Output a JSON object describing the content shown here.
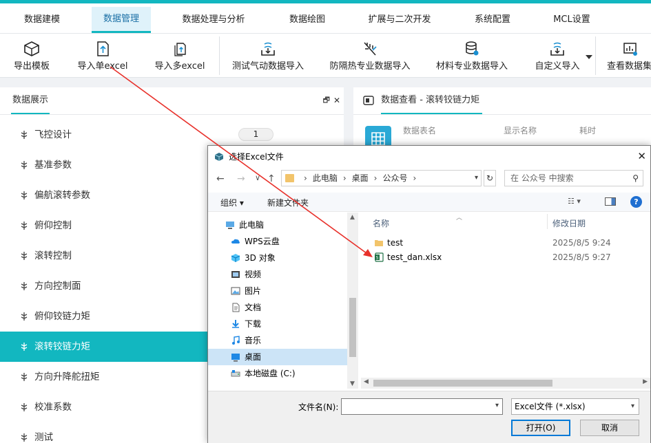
{
  "menu": {
    "tabs": [
      {
        "label": "数据建模"
      },
      {
        "label": "数据管理"
      },
      {
        "label": "数据处理与分析"
      },
      {
        "label": "数据绘图"
      },
      {
        "label": "扩展与二次开发"
      },
      {
        "label": "系统配置"
      },
      {
        "label": "MCL设置"
      }
    ],
    "active_index": 1
  },
  "toolbar": {
    "buttons": [
      {
        "label": "导出模板",
        "icon": "cube-icon"
      },
      {
        "label": "导入单excel",
        "icon": "import-file-icon"
      },
      {
        "label": "导入多excel",
        "icon": "import-multi-file-icon"
      },
      {
        "label": "测试气动数据导入",
        "icon": "import-tray-icon"
      },
      {
        "label": "防隔热专业数据导入",
        "icon": "heat-shield-icon"
      },
      {
        "label": "材料专业数据导入",
        "icon": "database-icon"
      },
      {
        "label": "自定义导入",
        "icon": "import-tray-icon"
      },
      {
        "label": "查看数据集",
        "icon": "dataset-view-icon"
      }
    ]
  },
  "left_panel": {
    "title": "数据展示",
    "pin_glyph": "🗗",
    "close_glyph": "✕",
    "badge": "1",
    "items": [
      {
        "label": "飞控设计"
      },
      {
        "label": "基准参数"
      },
      {
        "label": "偏航滚转参数"
      },
      {
        "label": "俯仰控制"
      },
      {
        "label": "滚转控制"
      },
      {
        "label": "方向控制面"
      },
      {
        "label": "俯仰铰链力矩"
      },
      {
        "label": "滚转铰链力矩"
      },
      {
        "label": "方向升降舵扭矩"
      },
      {
        "label": "校准系数"
      },
      {
        "label": "测试"
      }
    ],
    "selected_index": 7
  },
  "right_panel": {
    "title": "数据查看 - 滚转铰链力矩",
    "columns": [
      "数据表名",
      "显示名称",
      "耗时"
    ]
  },
  "dialog": {
    "title": "选择Excel文件",
    "close_glyph": "✕",
    "nav": {
      "back": "←",
      "forward": "→",
      "recent": "∨",
      "up": "↑",
      "refresh": "↻"
    },
    "address": [
      "此电脑",
      "桌面",
      "公众号"
    ],
    "address_sep": "›",
    "search_placeholder": "在 公众号 中搜索",
    "commands": {
      "organize": "组织 ▾",
      "new_folder": "新建文件夹",
      "help": "?",
      "view": "☷ ▾"
    },
    "nav_pane": [
      {
        "label": "此电脑",
        "icon": "computer-icon",
        "top": true
      },
      {
        "label": "WPS云盘",
        "icon": "cloud-icon"
      },
      {
        "label": "3D 对象",
        "icon": "3d-object-icon"
      },
      {
        "label": "视频",
        "icon": "video-icon"
      },
      {
        "label": "图片",
        "icon": "picture-icon"
      },
      {
        "label": "文档",
        "icon": "document-icon"
      },
      {
        "label": "下载",
        "icon": "download-icon"
      },
      {
        "label": "音乐",
        "icon": "music-icon"
      },
      {
        "label": "桌面",
        "icon": "desktop-icon",
        "selected": true
      },
      {
        "label": "本地磁盘 (C:)",
        "icon": "disk-icon"
      }
    ],
    "file_columns": {
      "name": "名称",
      "date": "修改日期"
    },
    "files": [
      {
        "name": "test",
        "date": "2025/8/5 9:24",
        "icon": "folder-icon"
      },
      {
        "name": "test_dan.xlsx",
        "date": "2025/8/5 9:27",
        "icon": "excel-file-icon"
      }
    ],
    "filename_label": "文件名(N):",
    "filename_value": "",
    "filetype": "Excel文件 (*.xlsx)",
    "open_button": "打开(O)",
    "cancel_button": "取消"
  },
  "colors": {
    "accent": "#12b7c0",
    "selection": "#12b7c0",
    "annotation_arrow": "#e8312b",
    "dialog_primary": "#0078d7"
  }
}
